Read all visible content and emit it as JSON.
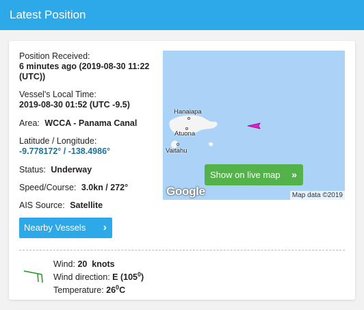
{
  "header": {
    "title": "Latest Position"
  },
  "position": {
    "received_label": "Position Received:",
    "received_value": "6 minutes ago (2019-08-30 11:22 (UTC))",
    "local_time_label": "Vessel's Local Time:",
    "local_time_value": "2019-08-30 01:52 (UTC -9.5)",
    "area_label": "Area:",
    "area_value": "WCCA - Panama Canal",
    "latlon_label": "Latitude / Longitude:",
    "latlon_value": "-9.778172° / -138.4986°",
    "status_label": "Status:",
    "status_value": "Underway",
    "speed_label": "Speed/Course:",
    "speed_value": "3.0kn / 272°",
    "ais_label": "AIS Source:",
    "ais_value": "Satellite"
  },
  "nearby_button": {
    "label": "Nearby Vessels"
  },
  "map": {
    "places": [
      "Hanaiapa",
      "Atuona",
      "Vaitahu"
    ],
    "live_button": "Show on live map",
    "logo": "Google",
    "attribution": "Map data ©2019"
  },
  "weather": {
    "wind_label": "Wind:",
    "wind_value": "20  knots",
    "direction_label": "Wind direction:",
    "direction_value": "E (105",
    "direction_deg": "0",
    "direction_close": ")",
    "temp_label": "Temperature:",
    "temp_value": "26",
    "temp_deg": "0",
    "temp_unit": "C"
  },
  "colors": {
    "accent": "#2da8e8",
    "live_button": "#53b24a",
    "vessel_marker": "#e81ccf",
    "wind_icon": "#1a9c1a"
  }
}
